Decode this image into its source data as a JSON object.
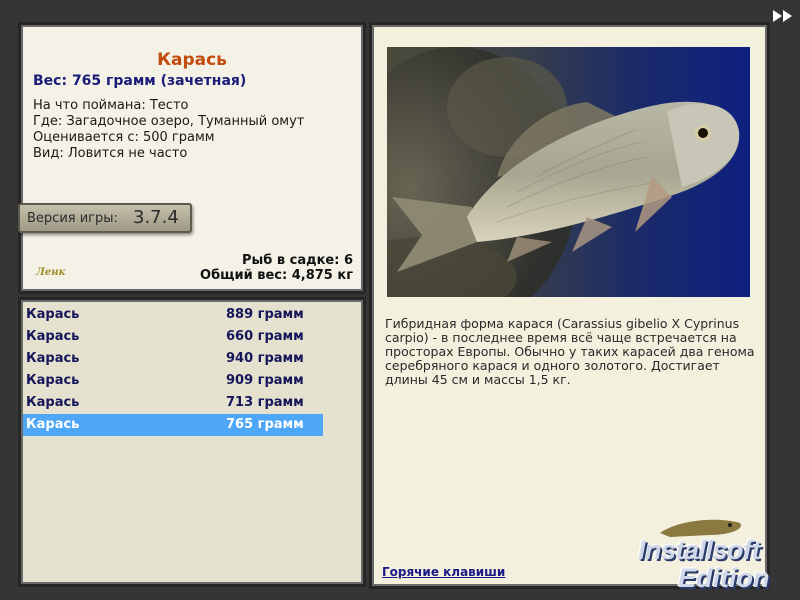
{
  "fish": {
    "name": "Карась",
    "weight_line": "Вес: 765 грамм (зачетная)",
    "bait_line": "На что поймана: Тесто",
    "place_line": "Где: Загадочное озеро, Туманный омут",
    "valued_line": "Оценивается с: 500 грамм",
    "frequency_line": "Вид: Ловится не часто"
  },
  "version": {
    "label": "Версия игры:",
    "number": "3.7.4"
  },
  "small_logo": "Ленк",
  "stats": {
    "fish_in_keepnet": "Рыб в садке: 6",
    "total_weight": "Общий вес: 4,875 кг"
  },
  "catch_list": [
    {
      "name": "Карась",
      "weight": "889 грамм"
    },
    {
      "name": "Карась",
      "weight": "660 грамм"
    },
    {
      "name": "Карась",
      "weight": "940 грамм"
    },
    {
      "name": "Карась",
      "weight": "909 грамм"
    },
    {
      "name": "Карась",
      "weight": "713 грамм"
    },
    {
      "name": "Карась",
      "weight": "765 грамм"
    }
  ],
  "selected_catch_index": 5,
  "description": "Гибридная форма карася (Carassius gibelio X Cyprinus carpio) - в последнее время всё чаще встречается на просторах Европы. Обычно у таких карасей два генома серебряного карася и одного золотого. Достигает длины 45 см и массы 1,5 кг.",
  "hotkeys_link": "Горячие клавиши",
  "brand": {
    "line1": "Installsoft",
    "line2": "Edition"
  },
  "colors": {
    "fish_name": "#c24a0c",
    "weight_text": "#1b1b78",
    "selected_row": "#4ea6f6",
    "list_text": "#16165a",
    "panel_bg": "#f4f2e6"
  }
}
